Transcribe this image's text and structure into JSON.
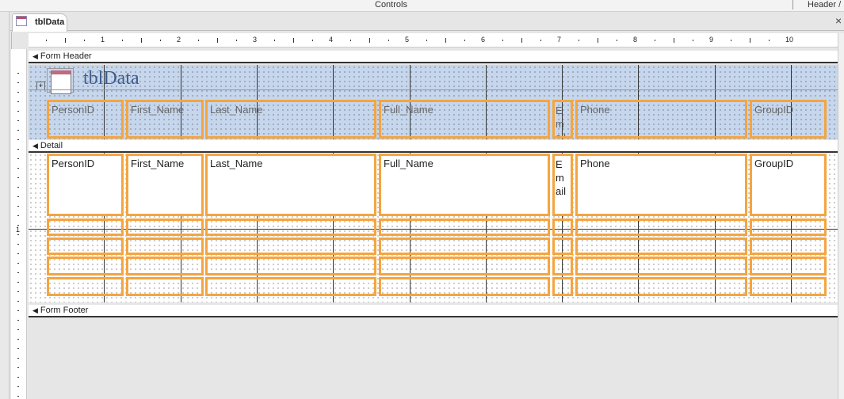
{
  "ribbon": {
    "group_controls": "Controls",
    "group_header": "Header /"
  },
  "tab": {
    "label": "tblData",
    "close": "×"
  },
  "ruler": {
    "marks": [
      "1",
      "2",
      "3",
      "4",
      "5",
      "6",
      "7",
      "8",
      "9",
      "10"
    ],
    "vertical_mark": "1"
  },
  "sections": {
    "header": "Form Header",
    "detail": "Detail",
    "footer": "Form Footer"
  },
  "form_title": "tblData",
  "header_labels": [
    "PersonID",
    "First_Name",
    "Last_Name",
    "Full_Name",
    "Email",
    "Phone",
    "GroupID"
  ],
  "email_wrapped": [
    "E",
    "m",
    "ail"
  ],
  "detail_fields": [
    "PersonID",
    "First_Name",
    "Last_Name",
    "Full_Name",
    "Email",
    "Phone",
    "GroupID"
  ],
  "colors": {
    "selection": "#f4a540",
    "header_bg": "#c6d6ec"
  }
}
